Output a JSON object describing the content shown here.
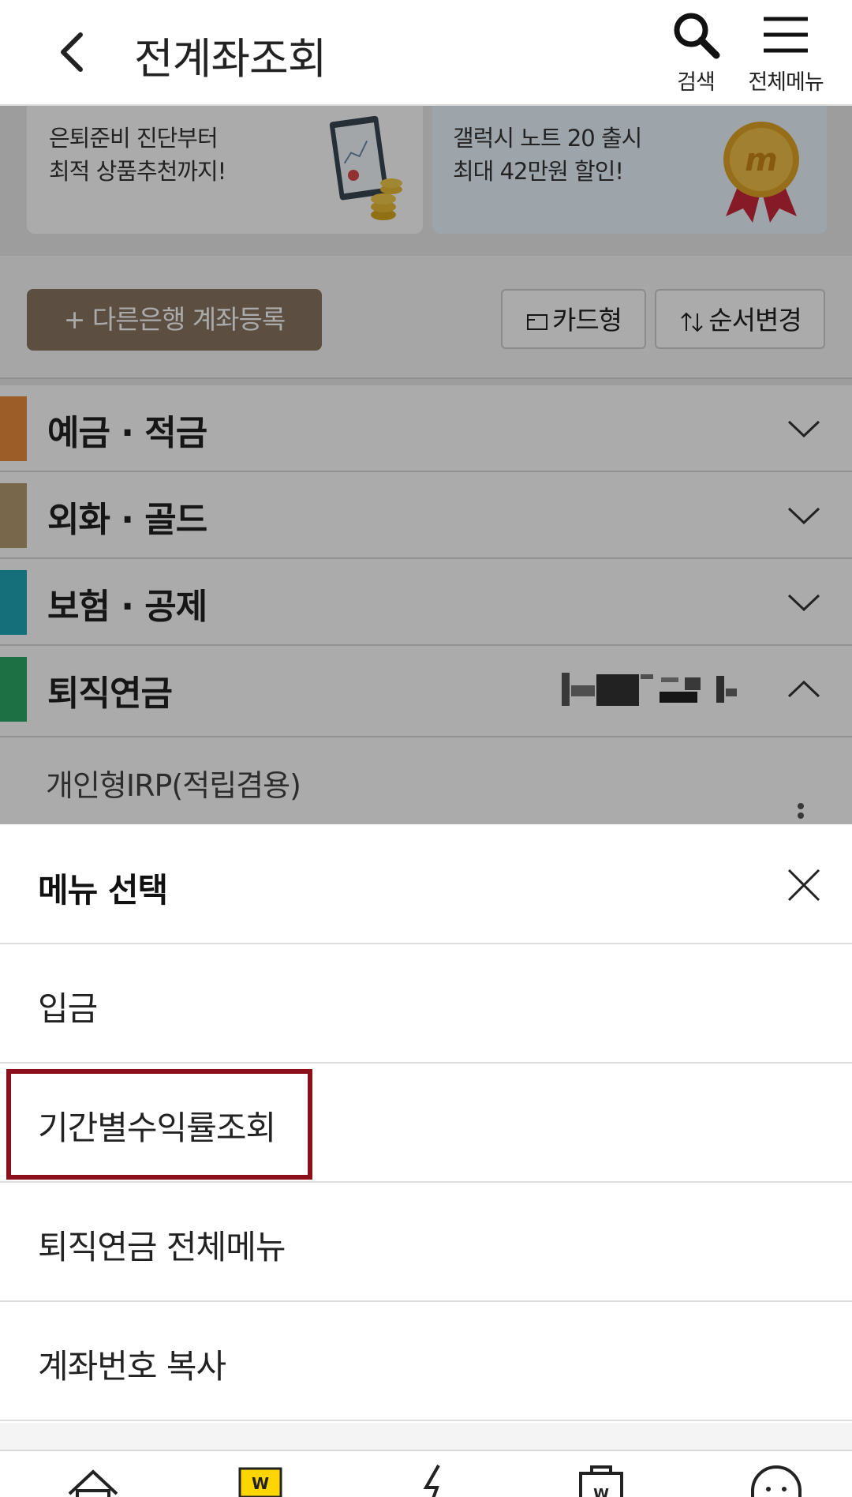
{
  "header": {
    "title": "전계좌조회",
    "search_label": "검색",
    "menu_label": "전체메뉴"
  },
  "banners": [
    {
      "line1": "은퇴준비 진단부터",
      "line2": "최적 상품추천까지!"
    },
    {
      "line1": "갤럭시 노트 20 출시",
      "line2": "최대 42만원 할인!"
    }
  ],
  "actions": {
    "add_bank": "+ 다른은행 계좌등록",
    "card_view": "카드형",
    "reorder": "순서변경"
  },
  "categories": [
    {
      "label": "예금 · 적금",
      "color": "#e98b3c",
      "expanded": false
    },
    {
      "label": "외화 · 골드",
      "color": "#b59a72",
      "expanded": false
    },
    {
      "label": "보험 · 공제",
      "color": "#1fa6b8",
      "expanded": false
    },
    {
      "label": "퇴직연금",
      "color": "#2aa864",
      "expanded": true
    }
  ],
  "expanded_account": {
    "label": "개인형IRP(적립겸용)"
  },
  "sheet": {
    "title": "메뉴 선택",
    "items": [
      {
        "label": "입금"
      },
      {
        "label": "기간별수익률조회",
        "highlighted": true
      },
      {
        "label": "퇴직연금 전체메뉴"
      },
      {
        "label": "계좌번호 복사"
      }
    ]
  },
  "colors": {
    "highlight": "#8c0f1c",
    "add_bank_button": "#8a7562"
  },
  "tabbar": {
    "icons": [
      "home-icon",
      "wallet-icon",
      "lightning-icon",
      "shopping-bag-icon",
      "chatbot-icon"
    ]
  }
}
